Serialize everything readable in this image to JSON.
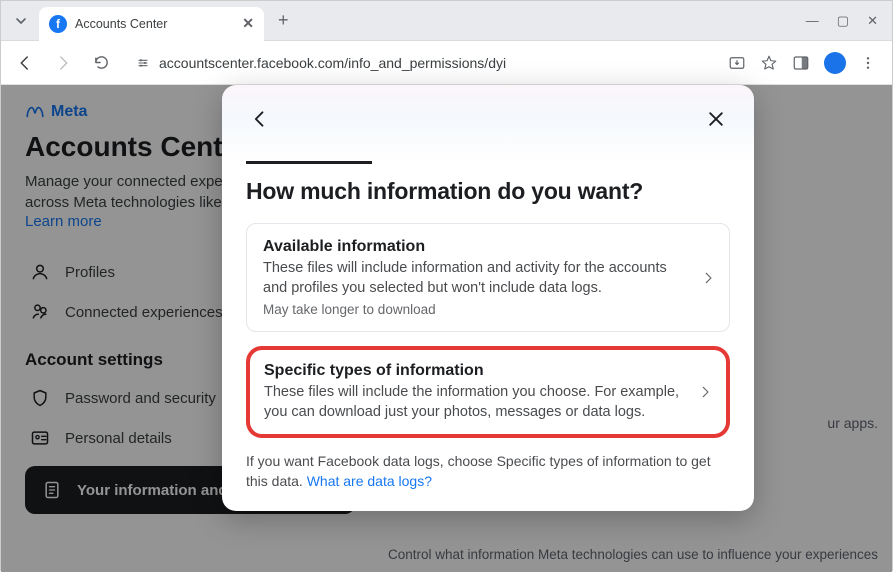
{
  "browser": {
    "tab_title": "Accounts Center",
    "url": "accountscenter.facebook.com/info_and_permissions/dyi"
  },
  "page": {
    "brand": "Meta",
    "title": "Accounts Center",
    "description": "Manage your connected experiences and account settings across Meta technologies like Facebook, Instagram and",
    "learn_more": "Learn more",
    "nav": {
      "profiles": "Profiles",
      "connected": "Connected experiences"
    },
    "section_head": "Account settings",
    "settings": {
      "password": "Password and security",
      "personal": "Personal details"
    },
    "active_item": "Your information and permissions",
    "right_panel_apps": "ur apps.",
    "right_panel_bottom": "Control what information Meta technologies can use to influence your experiences"
  },
  "modal": {
    "title": "How much information do you want?",
    "options": [
      {
        "title": "Available information",
        "desc": "These files will include information and activity for the accounts and profiles you selected but won't include data logs.",
        "sub": "May take longer to download"
      },
      {
        "title": "Specific types of information",
        "desc": "These files will include the information you choose. For example, you can download just your photos, messages or data logs."
      }
    ],
    "footer_text": "If you want Facebook data logs, choose Specific types of information to get this data. ",
    "footer_link": "What are data logs?"
  }
}
